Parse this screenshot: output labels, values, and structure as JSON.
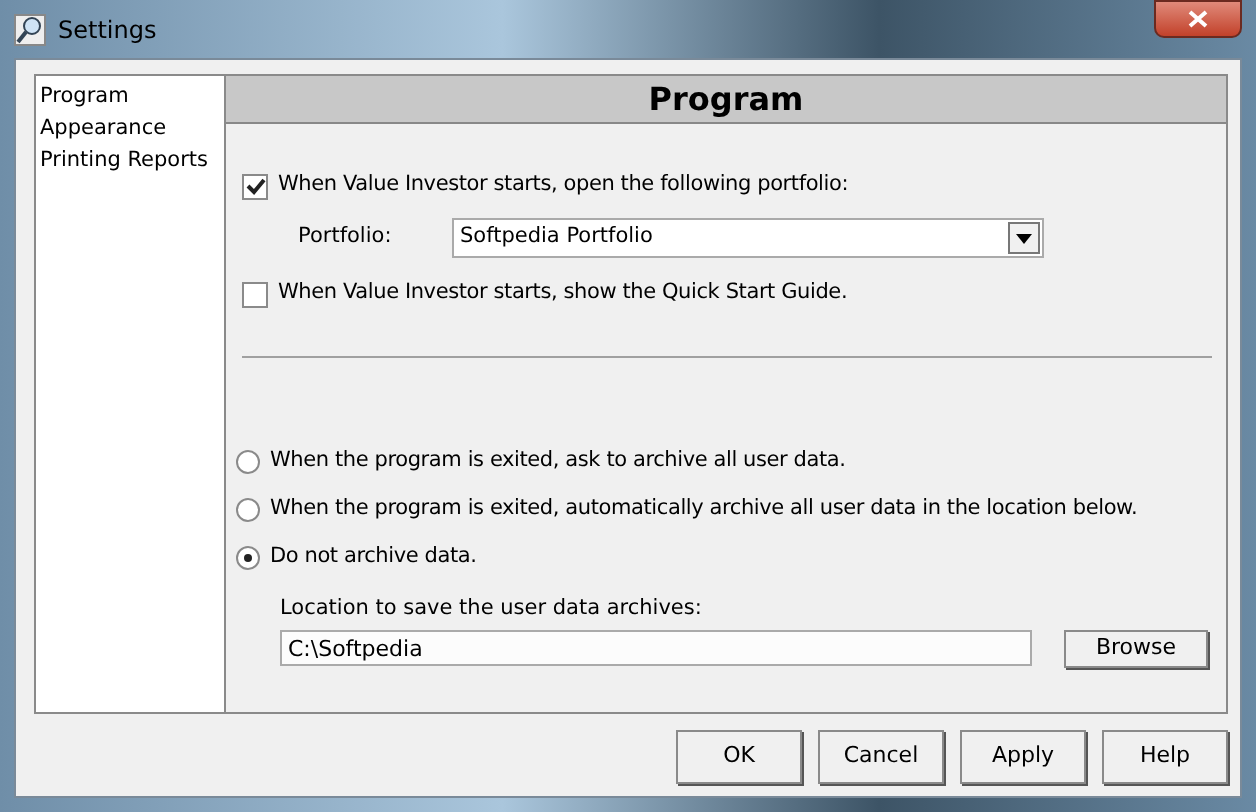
{
  "window": {
    "title": "Settings"
  },
  "sidebar": {
    "items": [
      {
        "label": "Program"
      },
      {
        "label": "Appearance"
      },
      {
        "label": "Printing Reports"
      }
    ]
  },
  "panel": {
    "title": "Program",
    "start_options": [
      {
        "label": "When Value Investor starts, open the following portfolio:",
        "checked": true
      },
      {
        "label": "When Value Investor starts, show the Quick Start Guide.",
        "checked": false
      }
    ],
    "portfolio": {
      "label": "Portfolio:",
      "value": "Softpedia Portfolio"
    },
    "archive_options": [
      {
        "label": "When the program is exited, ask to archive all user data.",
        "selected": false
      },
      {
        "label": "When the program is exited, automatically archive all user data in the location below.",
        "selected": false
      },
      {
        "label": "Do not archive data.",
        "selected": true
      }
    ],
    "location": {
      "label": "Location to save the user data archives:",
      "value": "C:\\Softpedia",
      "button": "Browse"
    }
  },
  "buttons": [
    "OK",
    "Cancel",
    "Apply",
    "Help"
  ]
}
